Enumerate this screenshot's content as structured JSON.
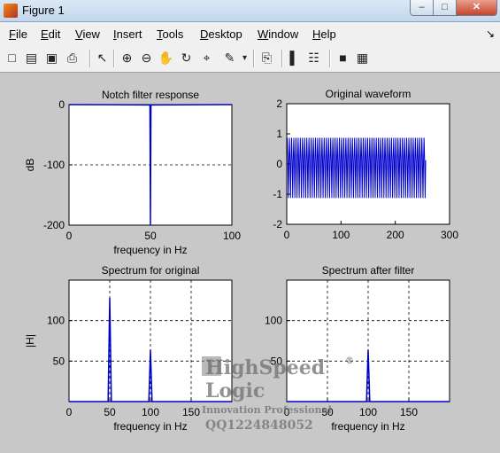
{
  "window": {
    "title": "Figure 1",
    "controls": [
      "–",
      "□",
      "✕"
    ]
  },
  "menubar": [
    "File",
    "Edit",
    "View",
    "Insert",
    "Tools",
    "Desktop",
    "Window",
    "Help"
  ],
  "menu_arrow": "↘",
  "toolbar": [
    {
      "name": "new-figure-icon",
      "glyph": "□"
    },
    {
      "name": "open-file-icon",
      "glyph": "▤"
    },
    {
      "name": "save-icon",
      "glyph": "▣"
    },
    {
      "name": "print-icon",
      "glyph": "⎙"
    },
    {
      "name": "select-arrow-icon",
      "glyph": "↖"
    },
    {
      "name": "zoom-in-icon",
      "glyph": "⊕"
    },
    {
      "name": "zoom-out-icon",
      "glyph": "⊖"
    },
    {
      "name": "pan-hand-icon",
      "glyph": "✋"
    },
    {
      "name": "rotate-3d-icon",
      "glyph": "↻"
    },
    {
      "name": "data-cursor-icon",
      "glyph": "⌖"
    },
    {
      "name": "brush-icon",
      "glyph": "✎"
    },
    {
      "name": "brush-dropdown-icon",
      "glyph": "▾"
    },
    {
      "name": "link-plot-icon",
      "glyph": "⎘"
    },
    {
      "name": "colorbar-icon",
      "glyph": "▌"
    },
    {
      "name": "legend-icon",
      "glyph": "☷"
    },
    {
      "name": "hide-plot-tools-icon",
      "glyph": "■"
    },
    {
      "name": "show-plot-tools-icon",
      "glyph": "▦"
    }
  ],
  "chart_data": [
    {
      "type": "line",
      "title": "Notch filter response",
      "xlabel": "frequency in Hz",
      "ylabel": "dB",
      "xlim": [
        0,
        100
      ],
      "ylim": [
        -200,
        0
      ],
      "xticks": [
        0,
        50,
        100
      ],
      "yticks": [
        -200,
        -100,
        0
      ],
      "grid": true,
      "series": [
        {
          "x": [
            0,
            49.7,
            50,
            50.3,
            100
          ],
          "y": [
            0,
            -0.5,
            -200,
            -0.5,
            0
          ]
        }
      ]
    },
    {
      "type": "line",
      "title": "Original waveform",
      "xlabel": "",
      "ylabel": "",
      "xlim": [
        0,
        300
      ],
      "ylim": [
        -2,
        2
      ],
      "xticks": [
        0,
        100,
        200,
        300
      ],
      "yticks": [
        -2,
        -1,
        0,
        1,
        2
      ],
      "grid": false,
      "signal": {
        "n": 256,
        "amplitude_low_freq": 1.0,
        "amplitude_high_freq": 0.2,
        "description_values": {
          "peak": 1.2,
          "trough": -1.2
        }
      },
      "series": [
        {
          "x_start": 1,
          "x_end": 256,
          "y_max": 1.2,
          "y_min": -1.2
        }
      ]
    },
    {
      "type": "line",
      "title": "Spectrum for original",
      "xlabel": "frequency in Hz",
      "ylabel": "|H|",
      "xlim": [
        0,
        200
      ],
      "ylim": [
        0,
        150
      ],
      "xticks": [
        0,
        50,
        100,
        150
      ],
      "yticks": [
        50,
        100
      ],
      "grid": true,
      "series": [
        {
          "x": [
            0,
            48,
            50,
            52,
            98,
            100,
            102,
            200
          ],
          "y": [
            0,
            0,
            128,
            0,
            0,
            64,
            0,
            0
          ]
        }
      ]
    },
    {
      "type": "line",
      "title": "Spectrum after filter",
      "xlabel": "frequency in Hz",
      "ylabel": "",
      "xlim": [
        0,
        200
      ],
      "ylim": [
        0,
        150
      ],
      "xticks": [
        0,
        50,
        100,
        150
      ],
      "yticks": [
        50,
        100
      ],
      "grid": true,
      "series": [
        {
          "x": [
            0,
            98,
            100,
            102,
            200
          ],
          "y": [
            0,
            0,
            64,
            0,
            0
          ]
        }
      ]
    }
  ],
  "watermark": {
    "lines": [
      "HighSpeed",
      "Logic",
      "Innovation Professional",
      "QQ1224848052"
    ],
    "registered_mark": "®"
  },
  "colors": {
    "line": "#0000cc",
    "axes_bg": "#ffffff",
    "figure_bg": "#c8c8c8"
  }
}
